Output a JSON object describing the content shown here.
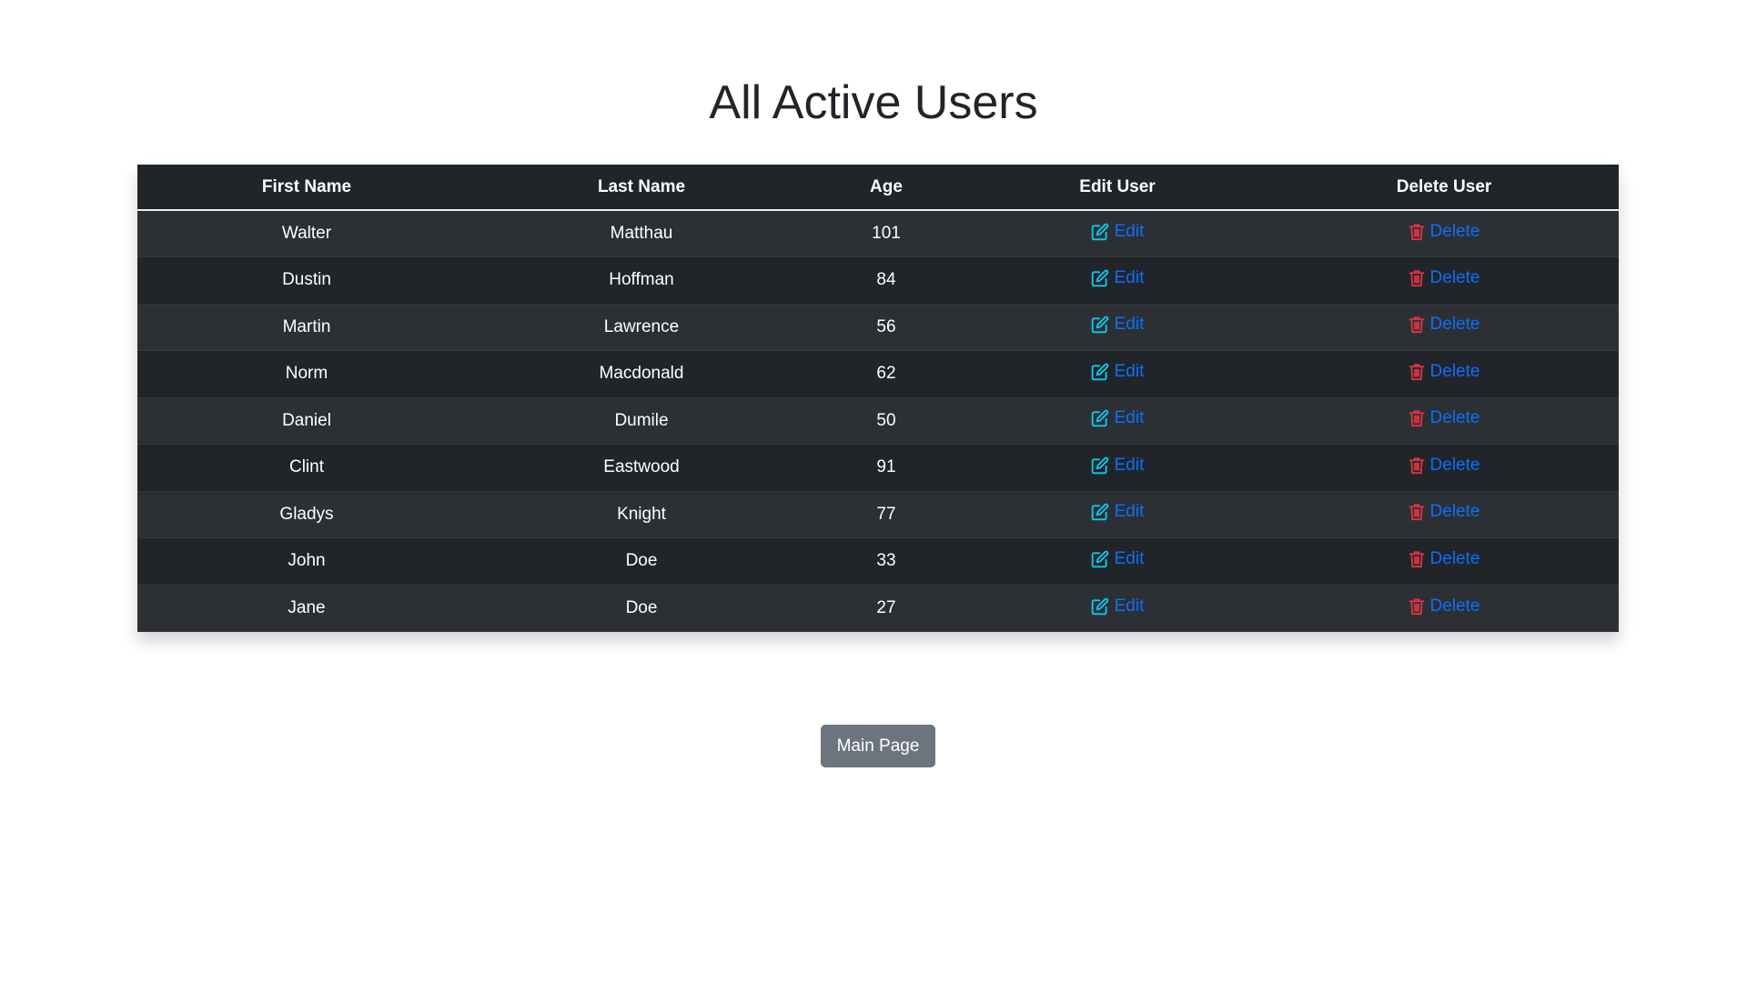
{
  "page": {
    "title": "All Active Users"
  },
  "table": {
    "headers": [
      "First Name",
      "Last Name",
      "Age",
      "Edit User",
      "Delete User"
    ],
    "edit_label": "Edit",
    "delete_label": "Delete",
    "rows": [
      {
        "first": "Walter",
        "last": "Matthau",
        "age": "101"
      },
      {
        "first": "Dustin",
        "last": "Hoffman",
        "age": "84"
      },
      {
        "first": "Martin",
        "last": "Lawrence",
        "age": "56"
      },
      {
        "first": "Norm",
        "last": "Macdonald",
        "age": "62"
      },
      {
        "first": "Daniel",
        "last": "Dumile",
        "age": "50"
      },
      {
        "first": "Clint",
        "last": "Eastwood",
        "age": "91"
      },
      {
        "first": "Gladys",
        "last": "Knight",
        "age": "77"
      },
      {
        "first": "John",
        "last": "Doe",
        "age": "33"
      },
      {
        "first": "Jane",
        "last": "Doe",
        "age": "27"
      }
    ]
  },
  "footer": {
    "main_page_label": "Main Page"
  },
  "colors": {
    "table_header_bg": "#212529",
    "row_odd_bg": "#2c3034",
    "row_even_bg": "#212529",
    "link": "#0d6efd",
    "edit_icon": "#0dcaf0",
    "delete_icon": "#dc3545",
    "button_bg": "#6c757d"
  },
  "icons": {
    "edit": "edit-icon",
    "delete": "trash-icon"
  }
}
